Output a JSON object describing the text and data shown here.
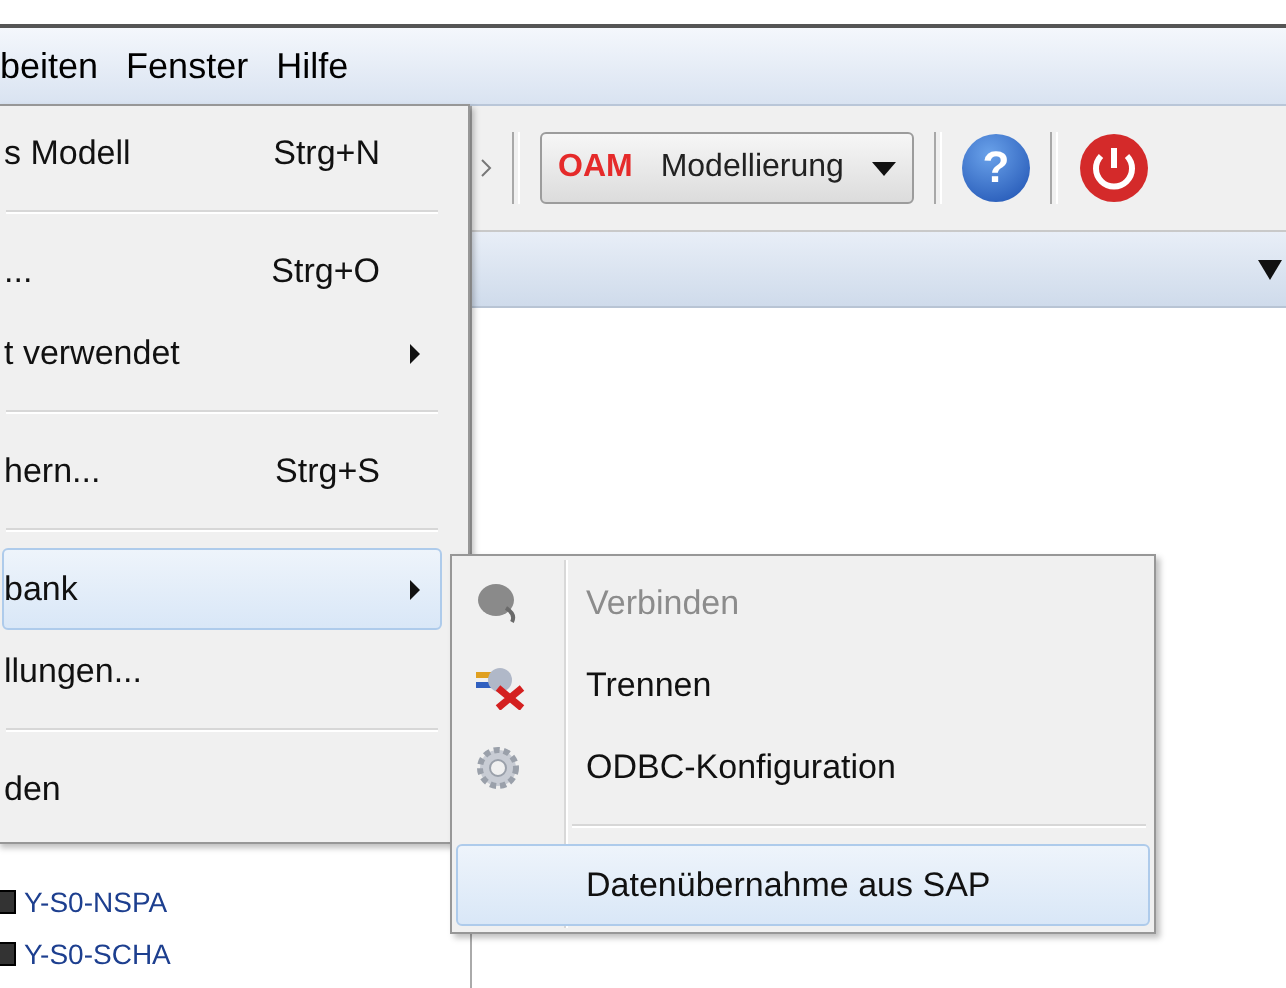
{
  "menubar": [
    {
      "label": "beiten"
    },
    {
      "label": "Fenster"
    },
    {
      "label": "Hilfe"
    }
  ],
  "toolbar": {
    "combo": {
      "prefix": "OAM",
      "value": "Modellierung"
    },
    "help": "?"
  },
  "tree": [
    {
      "label": "Y-S0-NSPA"
    },
    {
      "label": "Y-S0-SCHA"
    }
  ],
  "menu": [
    {
      "kind": "item",
      "label": "s Modell",
      "shortcut": "Strg+N",
      "submenu": false,
      "selected": false
    },
    {
      "kind": "separator"
    },
    {
      "kind": "item",
      "label": "...",
      "shortcut": "Strg+O",
      "submenu": false,
      "selected": false
    },
    {
      "kind": "item",
      "label": "t verwendet",
      "submenu": true,
      "selected": false
    },
    {
      "kind": "separator"
    },
    {
      "kind": "item",
      "label": "hern...",
      "shortcut": "Strg+S",
      "submenu": false,
      "selected": false
    },
    {
      "kind": "separator"
    },
    {
      "kind": "item",
      "label": "bank",
      "submenu": true,
      "selected": true
    },
    {
      "kind": "item",
      "label": "llungen...",
      "submenu": false,
      "selected": false
    },
    {
      "kind": "separator"
    },
    {
      "kind": "item",
      "label": "den",
      "submenu": false,
      "selected": false
    }
  ],
  "submenu": [
    {
      "kind": "item",
      "label": "Verbinden",
      "disabled": true,
      "selected": false
    },
    {
      "kind": "item",
      "label": "Trennen",
      "disabled": false,
      "selected": false
    },
    {
      "kind": "item",
      "label": "ODBC-Konfiguration",
      "disabled": false,
      "selected": false
    },
    {
      "kind": "separator"
    },
    {
      "kind": "item",
      "label": "Datenübernahme aus SAP",
      "disabled": false,
      "selected": true
    }
  ]
}
